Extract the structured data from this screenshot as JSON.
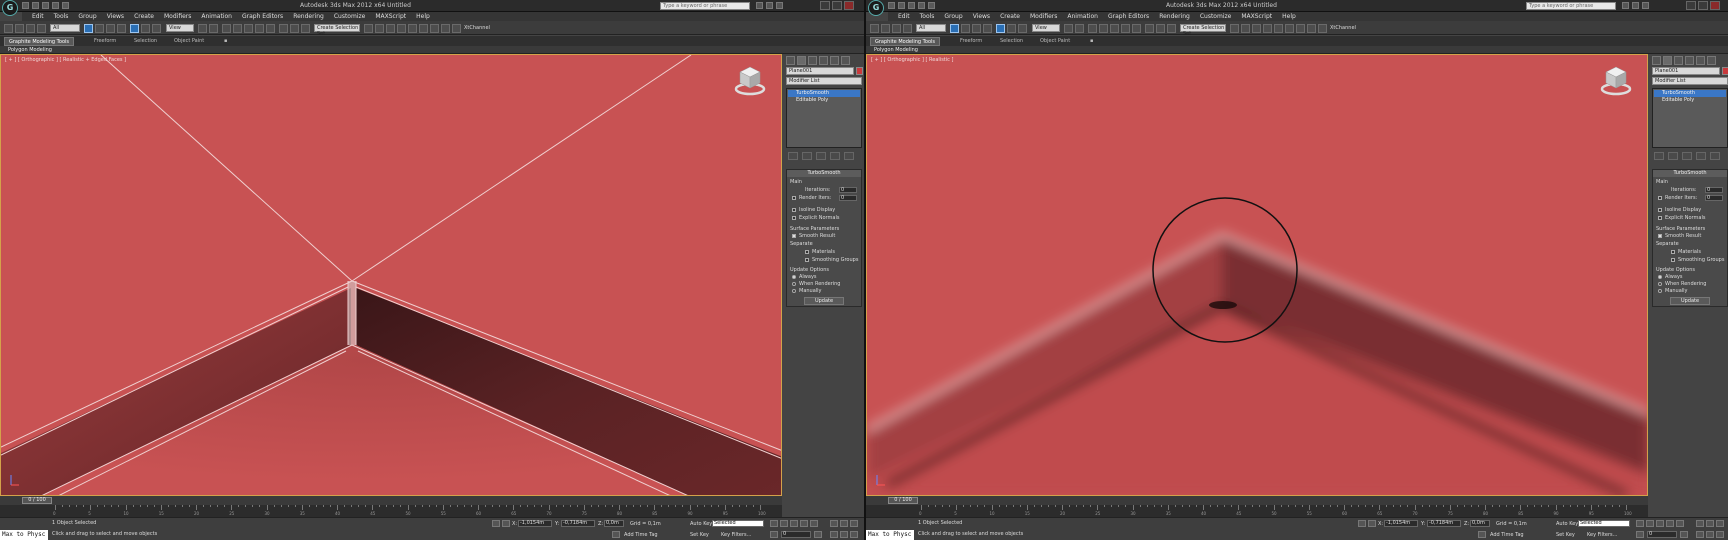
{
  "window": {
    "title": "Autodesk 3ds Max  2012 x64    Untitled",
    "search_placeholder": "Type a keyword or phrase"
  },
  "menu": [
    "Edit",
    "Tools",
    "Group",
    "Views",
    "Create",
    "Modifiers",
    "Animation",
    "Graph Editors",
    "Rendering",
    "Customize",
    "MAXScript",
    "Help"
  ],
  "toolbar": {
    "selection_filter": "All",
    "ref_coord": "View",
    "named_selection": "Create Selection Set",
    "channel_label": "XtChannel"
  },
  "ribbon": {
    "tabs": [
      "Graphite Modeling Tools",
      "Freeform",
      "Selection",
      "Object Paint"
    ],
    "panel_label": "Polygon Modeling"
  },
  "panels": [
    {
      "viewport_label": "[ + ] [ Orthographic ] [ Realistic + Edged Faces ]",
      "wireframe": true,
      "circle_highlight": false
    },
    {
      "viewport_label": "[ + ] [ Orthographic ] [ Realistic ]",
      "wireframe": false,
      "circle_highlight": true
    }
  ],
  "command_panel": {
    "object_name": "Plane001",
    "object_color": "#c8393c",
    "modifier_list": "Modifier List",
    "stack": [
      {
        "label": "TurboSmooth",
        "selected": true
      },
      {
        "label": "Editable Poly",
        "selected": false
      }
    ],
    "turbosmooth": {
      "title": "TurboSmooth",
      "main": "Main",
      "iterations_label": "Iterations:",
      "iterations_value": "0",
      "render_iters_label": "Render Iters:",
      "render_iters_value": "0",
      "isoline": "Isoline Display",
      "explicit_normals": "Explicit Normals",
      "surface_params": "Surface Parameters",
      "smooth_result": "Smooth Result",
      "separate": "Separate",
      "materials": "Materials",
      "smoothing_groups": "Smoothing Groups",
      "update_options": "Update Options",
      "always": "Always",
      "when_rendering": "When Rendering",
      "manually": "Manually",
      "update_button": "Update"
    }
  },
  "timeline": {
    "frame": "0 / 100",
    "ticks": [
      0,
      5,
      10,
      15,
      20,
      25,
      30,
      35,
      40,
      45,
      50,
      55,
      60,
      65,
      70,
      75,
      80,
      85,
      90,
      95,
      100
    ]
  },
  "status": {
    "maxscript": "Max to Physc",
    "selected": "1 Object Selected",
    "prompt": "Click and drag to select and move objects",
    "x_label": "X:",
    "x_value": "-1,0154m",
    "y_label": "Y:",
    "y_value": "-0,7184m",
    "z_label": "Z:",
    "z_value": "0,0m",
    "grid": "Grid = 0,1m",
    "autokey": "Auto Key",
    "autokey_sel": "Selected",
    "setkey": "Set Key",
    "key_filters": "Key Filters...",
    "add_time_tag": "Add Time Tag",
    "frame_field": "0"
  }
}
